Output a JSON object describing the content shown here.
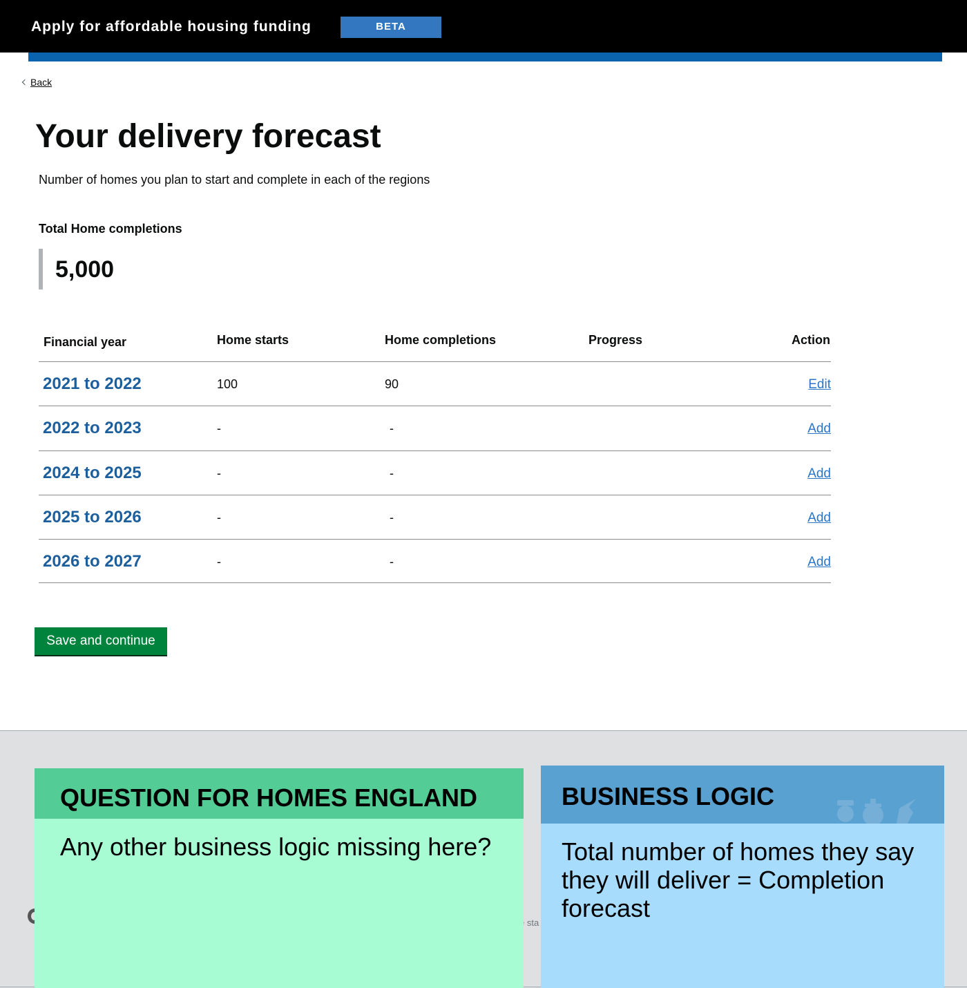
{
  "header": {
    "service_name": "Apply for affordable housing funding",
    "phase_tag": "BETA"
  },
  "nav": {
    "back_label": "Back"
  },
  "page": {
    "title": "Your delivery forecast",
    "lead": "Number of homes you plan to start and complete in each of the regions"
  },
  "summary": {
    "total_label": "Total Home completions",
    "total_value": "5,000"
  },
  "table": {
    "headers": {
      "year": "Financial year",
      "starts": "Home starts",
      "completions": "Home completions",
      "progress": "Progress",
      "action": "Action"
    },
    "rows": [
      {
        "year": "2021 to 2022",
        "starts": "100",
        "completions": "90",
        "progress": "",
        "action": "Edit"
      },
      {
        "year": "2022 to 2023",
        "starts": "-",
        "completions": "-",
        "progress": "",
        "action": "Add"
      },
      {
        "year": "2024 to 2025",
        "starts": "-",
        "completions": "-",
        "progress": "",
        "action": "Add"
      },
      {
        "year": "2025 to 2026",
        "starts": "-",
        "completions": "-",
        "progress": "",
        "action": "Add"
      },
      {
        "year": "2026 to 2027",
        "starts": "-",
        "completions": "-",
        "progress": "",
        "action": "Add"
      }
    ]
  },
  "actions": {
    "save_label": "Save and continue"
  },
  "footer": {
    "peek_text": "e sta"
  },
  "notes": {
    "question": {
      "title": "QUESTION FOR HOMES ENGLAND",
      "body": "Any other business logic missing here?"
    },
    "logic": {
      "title": "BUSINESS LOGIC",
      "body": "Total number of homes they say they will deliver = Completion forecast"
    }
  },
  "colors": {
    "header_bg": "#000000",
    "beta_tag": "#3377c0",
    "header_stripe": "#0b63ad",
    "link": "#1d5f9c",
    "button": "#00843d",
    "footer_bg": "#dee0e2",
    "note_green": "#a7fcd4",
    "note_green_head": "#53cc96",
    "note_blue": "#a8dcfd",
    "note_blue_head": "#58a1d0"
  },
  "icons": {
    "back": "chevron-left-icon",
    "crest": "royal-crest-icon"
  }
}
